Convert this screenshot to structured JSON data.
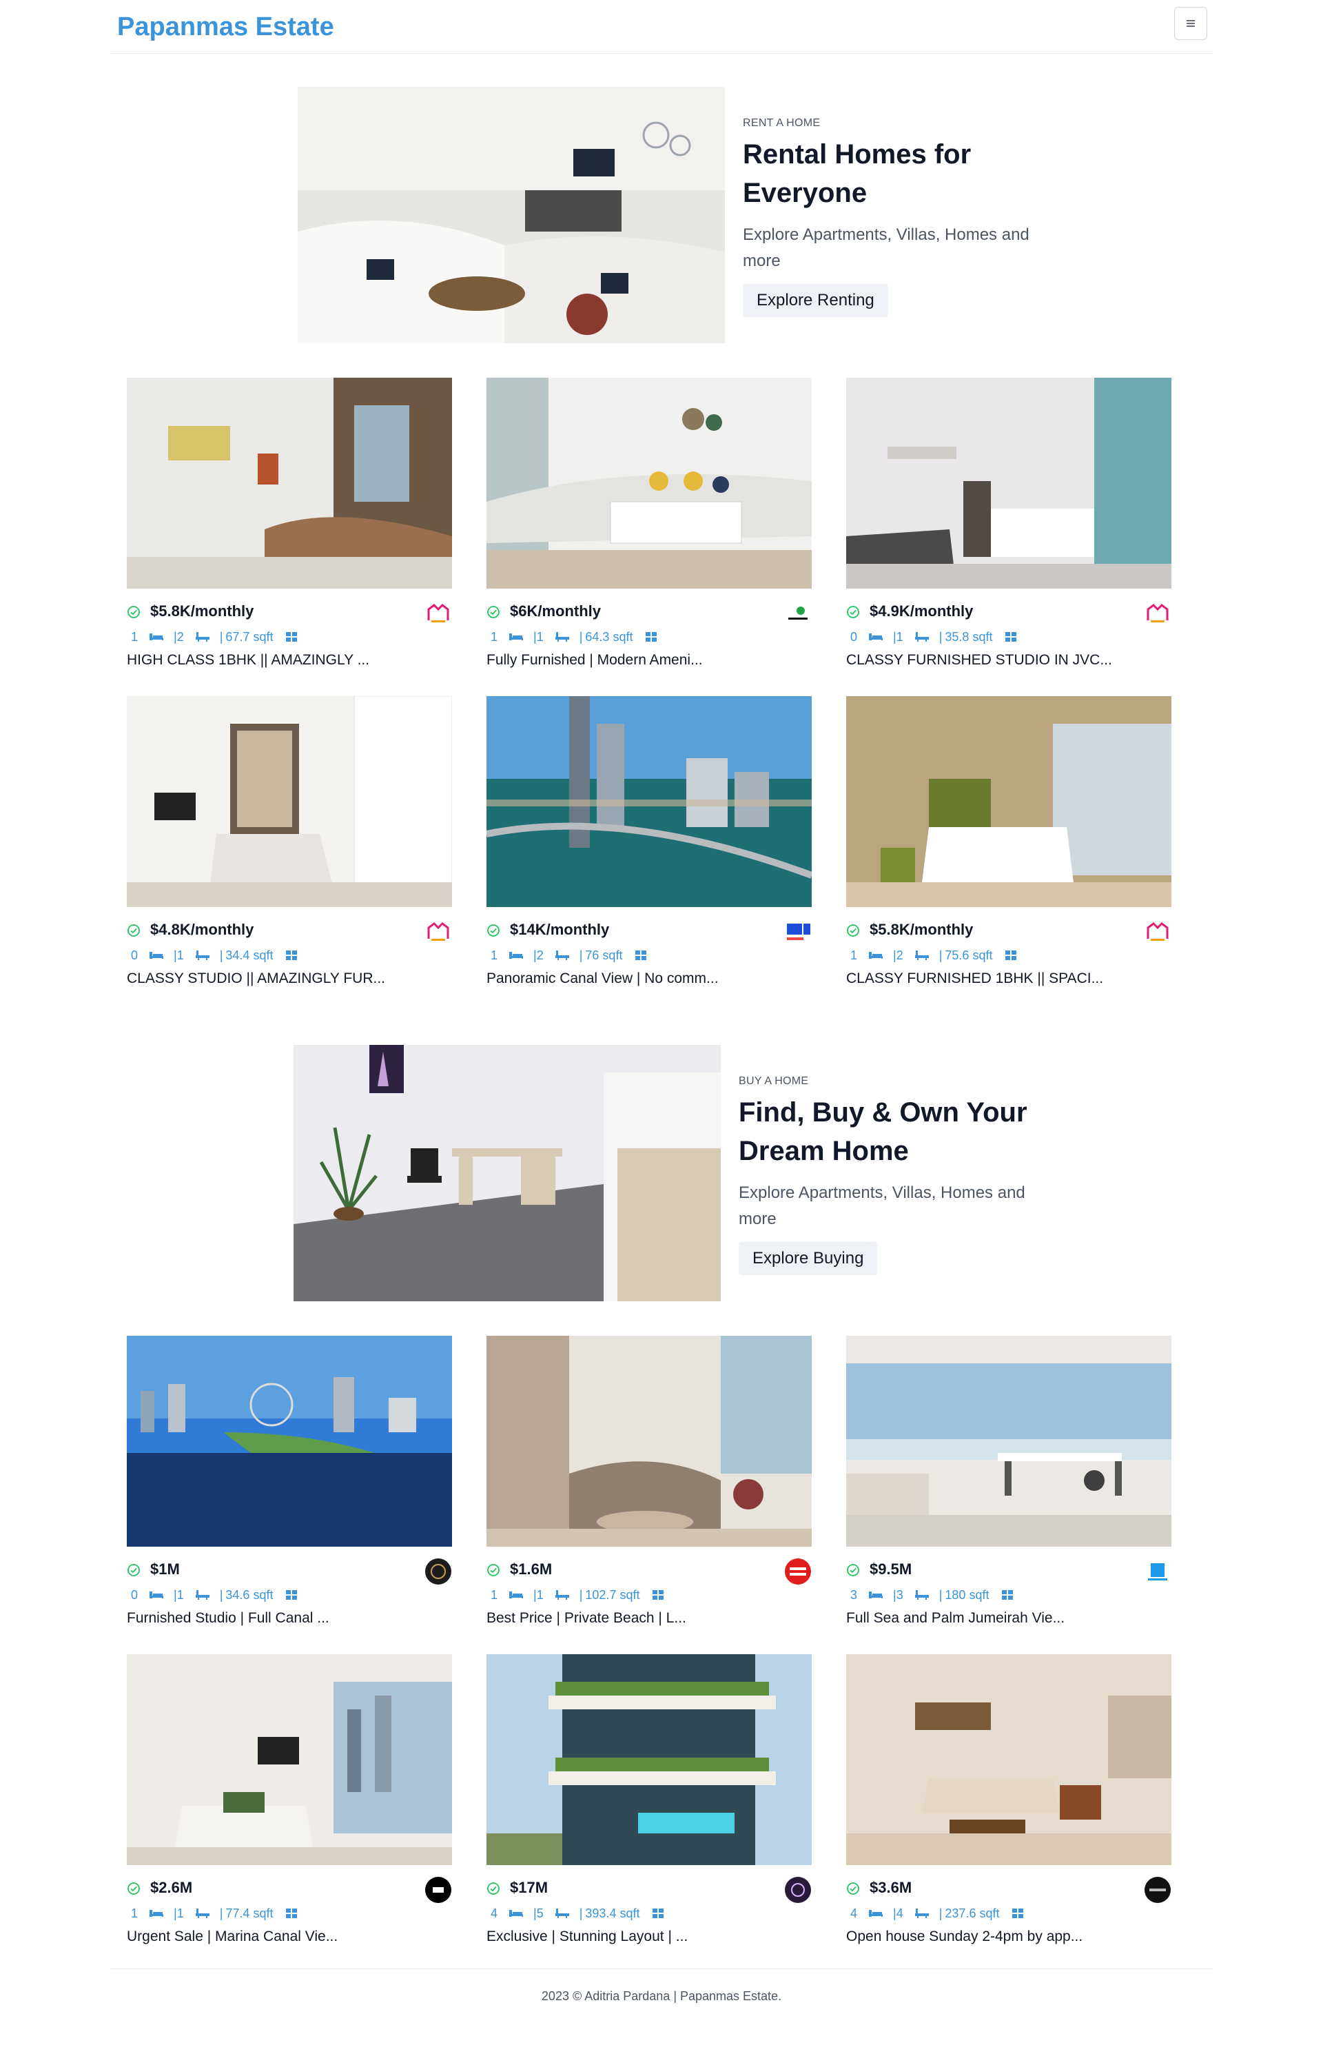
{
  "nav": {
    "brand": "Papanmas Estate"
  },
  "rent_hero": {
    "eyebrow": "RENT A HOME",
    "title": "Rental Homes for Everyone",
    "subtitle": "Explore Apartments, Villas, Homes and more",
    "button": "Explore Renting"
  },
  "rent_listings": [
    {
      "price": "$5.8K/monthly",
      "beds": "1",
      "baths": "2",
      "area": "67.7 sqft",
      "title": "HIGH CLASS 1BHK || AMAZINGLY ..."
    },
    {
      "price": "$6K/monthly",
      "beds": "1",
      "baths": "1",
      "area": "64.3 sqft",
      "title": "Fully Furnished | Modern Ameni..."
    },
    {
      "price": "$4.9K/monthly",
      "beds": "0",
      "baths": "1",
      "area": "35.8 sqft",
      "title": "CLASSY FURNISHED STUDIO IN JVC..."
    },
    {
      "price": "$4.8K/monthly",
      "beds": "0",
      "baths": "1",
      "area": "34.4 sqft",
      "title": "CLASSY STUDIO || AMAZINGLY FUR..."
    },
    {
      "price": "$14K/monthly",
      "beds": "1",
      "baths": "2",
      "area": "76 sqft",
      "title": "Panoramic Canal View | No comm..."
    },
    {
      "price": "$5.8K/monthly",
      "beds": "1",
      "baths": "2",
      "area": "75.6 sqft",
      "title": "CLASSY FURNISHED 1BHK || SPACI..."
    }
  ],
  "buy_hero": {
    "eyebrow": "BUY A HOME",
    "title": "Find, Buy & Own Your Dream Home",
    "subtitle": "Explore Apartments, Villas, Homes and more",
    "button": "Explore Buying"
  },
  "buy_listings": [
    {
      "price": "$1M",
      "beds": "0",
      "baths": "1",
      "area": "34.6 sqft",
      "title": "Furnished Studio | Full Canal ..."
    },
    {
      "price": "$1.6M",
      "beds": "1",
      "baths": "1",
      "area": "102.7 sqft",
      "title": "Best Price | Private Beach | L..."
    },
    {
      "price": "$9.5M",
      "beds": "3",
      "baths": "3",
      "area": "180 sqft",
      "title": "Full Sea and Palm Jumeirah Vie..."
    },
    {
      "price": "$2.6M",
      "beds": "1",
      "baths": "1",
      "area": "77.4 sqft",
      "title": "Urgent Sale | Marina Canal Vie..."
    },
    {
      "price": "$17M",
      "beds": "4",
      "baths": "5",
      "area": "393.4 sqft",
      "title": "Exclusive | Stunning Layout | ..."
    },
    {
      "price": "$3.6M",
      "beds": "4",
      "baths": "4",
      "area": "237.6 sqft",
      "title": "Open house Sunday 2-4pm by app..."
    }
  ],
  "footer": {
    "text": "2023 © Aditria Pardana | Papanmas Estate."
  },
  "colors": {
    "brand": "#3b94d9",
    "check": "#22c55e",
    "spec": "#3b94d9"
  }
}
